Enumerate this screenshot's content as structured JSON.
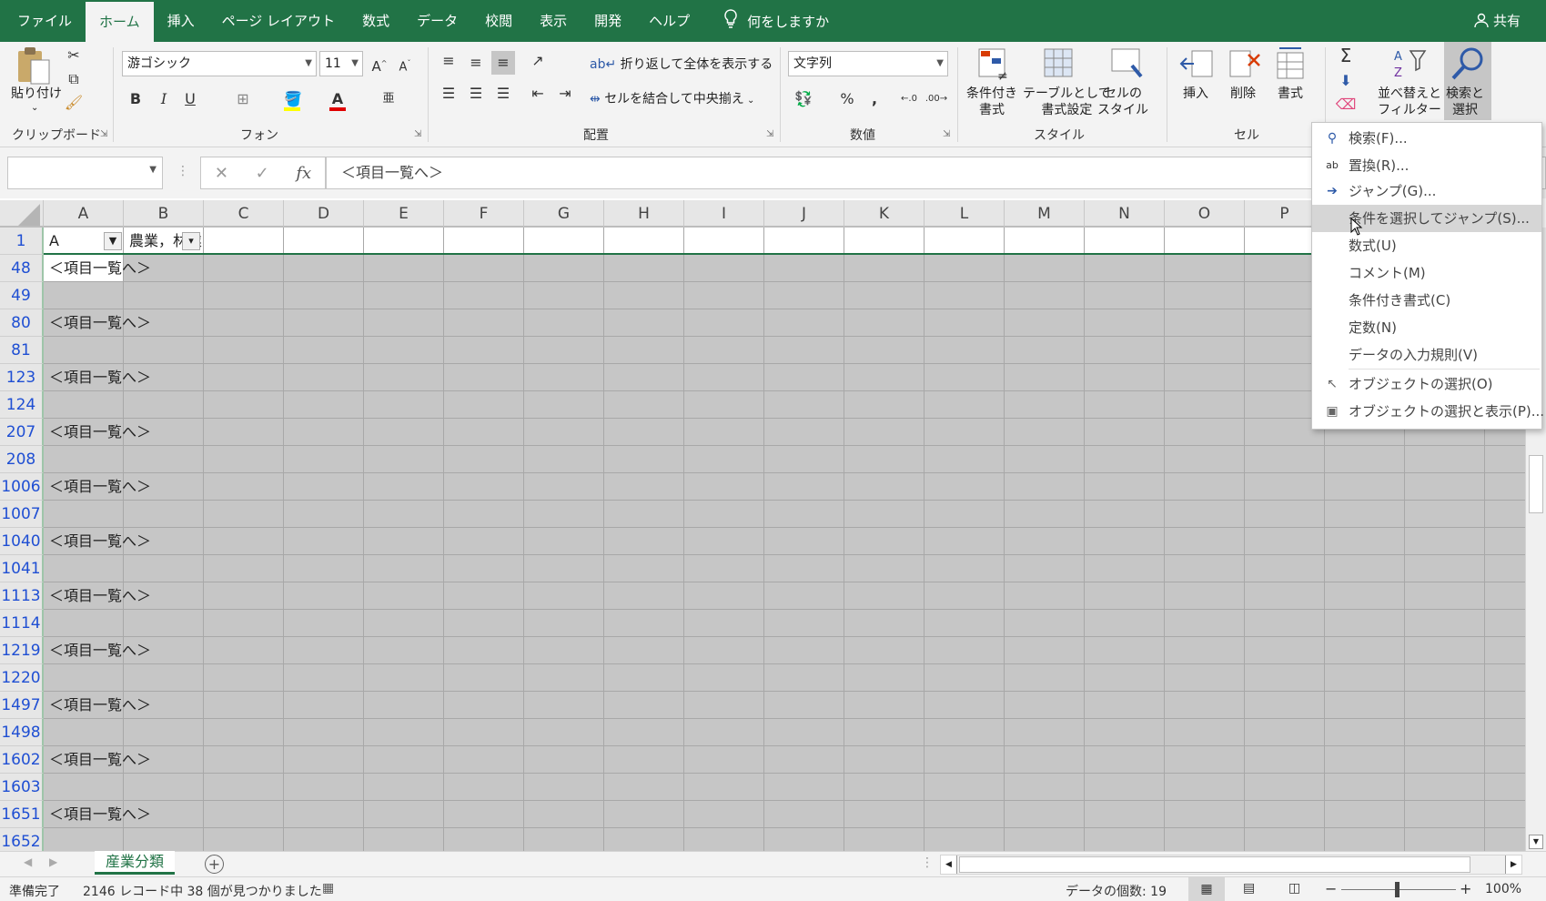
{
  "tabs": [
    "ファイル",
    "ホーム",
    "挿入",
    "ページ レイアウト",
    "数式",
    "データ",
    "校閲",
    "表示",
    "開発",
    "ヘルプ"
  ],
  "active_tab": "ホーム",
  "tell_me": "何をしますか",
  "share": "共有",
  "ribbon": {
    "clipboard": {
      "paste": "貼り付け",
      "label": "クリップボード"
    },
    "font": {
      "name": "游ゴシック",
      "size": "11",
      "label": "フォント",
      "bold": "B",
      "italic": "I",
      "underline": "U"
    },
    "alignment": {
      "wrap": "折り返して全体を表示する",
      "merge": "セルを結合して中央揃え",
      "label": "配置"
    },
    "number": {
      "format": "文字列",
      "percent": "%",
      "comma": ",",
      "label": "数値"
    },
    "styles": {
      "conditional": "条件付き\n書式",
      "table": "テーブルとして\n書式設定",
      "cell": "セルの\nスタイル",
      "label": "スタイル"
    },
    "cells": {
      "insert": "挿入",
      "delete": "削除",
      "format": "書式",
      "label": "セル"
    },
    "editing": {
      "sort": "並べ替えと\nフィルター",
      "find": "検索と\n選択"
    }
  },
  "formula": {
    "namebox": "",
    "content": "＜項目一覧へ＞"
  },
  "columns": [
    "A",
    "B",
    "C",
    "D",
    "E",
    "F",
    "G",
    "H",
    "I",
    "J",
    "K",
    "L",
    "M",
    "N",
    "O",
    "P"
  ],
  "header_row": {
    "num": "1",
    "a": "A",
    "b": "農業，林業"
  },
  "rows": [
    {
      "num": "48",
      "a": "＜項目一覧へ＞"
    },
    {
      "num": "49",
      "a": ""
    },
    {
      "num": "80",
      "a": "＜項目一覧へ＞"
    },
    {
      "num": "81",
      "a": ""
    },
    {
      "num": "123",
      "a": "＜項目一覧へ＞"
    },
    {
      "num": "124",
      "a": ""
    },
    {
      "num": "207",
      "a": "＜項目一覧へ＞"
    },
    {
      "num": "208",
      "a": ""
    },
    {
      "num": "1006",
      "a": "＜項目一覧へ＞"
    },
    {
      "num": "1007",
      "a": ""
    },
    {
      "num": "1040",
      "a": "＜項目一覧へ＞"
    },
    {
      "num": "1041",
      "a": ""
    },
    {
      "num": "1113",
      "a": "＜項目一覧へ＞"
    },
    {
      "num": "1114",
      "a": ""
    },
    {
      "num": "1219",
      "a": "＜項目一覧へ＞"
    },
    {
      "num": "1220",
      "a": ""
    },
    {
      "num": "1497",
      "a": "＜項目一覧へ＞"
    },
    {
      "num": "1498",
      "a": ""
    },
    {
      "num": "1602",
      "a": "＜項目一覧へ＞"
    },
    {
      "num": "1603",
      "a": ""
    },
    {
      "num": "1651",
      "a": "＜項目一覧へ＞"
    },
    {
      "num": "1652",
      "a": ""
    }
  ],
  "sheet_tab": "産業分類",
  "status": {
    "ready": "準備完了",
    "found": "2146 レコード中 38 個が見つかりました",
    "count": "データの個数: 19",
    "zoom": "100%"
  },
  "menu": [
    {
      "label": "検索(F)...",
      "icon": "search-icon"
    },
    {
      "label": "置換(R)...",
      "icon": "replace-icon"
    },
    {
      "label": "ジャンプ(G)...",
      "icon": "arrow-right-icon"
    },
    {
      "label": "条件を選択してジャンプ(S)...",
      "icon": "",
      "highlighted": true
    },
    {
      "label": "数式(U)",
      "icon": ""
    },
    {
      "label": "コメント(M)",
      "icon": ""
    },
    {
      "label": "条件付き書式(C)",
      "icon": ""
    },
    {
      "label": "定数(N)",
      "icon": ""
    },
    {
      "label": "データの入力規則(V)",
      "icon": ""
    },
    {
      "label": "オブジェクトの選択(O)",
      "icon": "pointer-icon"
    },
    {
      "label": "オブジェクトの選択と表示(P)...",
      "icon": "selection-pane-icon"
    }
  ]
}
